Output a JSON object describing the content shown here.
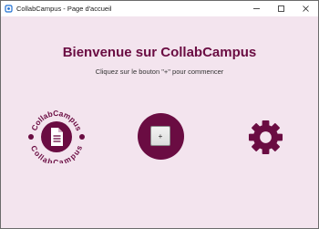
{
  "window": {
    "title": "CollabCampus - Page d'accueil"
  },
  "main": {
    "heading": "Bienvenue sur CollabCampus",
    "subtitle": "Cliquez sur le bouton \"+\" pour commencer"
  },
  "logo": {
    "ring_text": "CollabCampus",
    "icon": "document-icon"
  },
  "add_button": {
    "label": "+"
  },
  "settings": {
    "icon": "gear-icon"
  },
  "colors": {
    "background": "#f3e4ee",
    "brand": "#6a0c42"
  }
}
